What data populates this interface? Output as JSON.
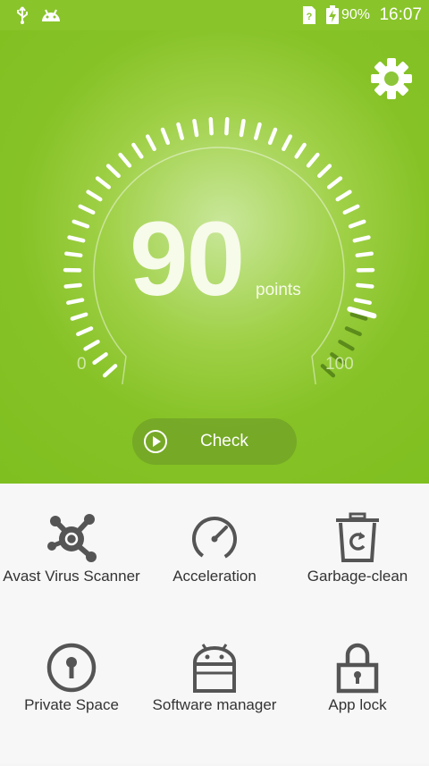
{
  "status_bar": {
    "battery": "90%",
    "time": "16:07"
  },
  "gauge": {
    "score": "90",
    "unit": "points",
    "min_label": "0",
    "max_label": "100",
    "level": 0.9
  },
  "check_button": {
    "label": "Check"
  },
  "tools": [
    {
      "label": "Avast Virus Scanner",
      "icon": "avast-icon"
    },
    {
      "label": "Acceleration",
      "icon": "speedometer-icon"
    },
    {
      "label": "Garbage-clean",
      "icon": "trash-recycle-icon"
    },
    {
      "label": "Private Space",
      "icon": "keyhole-icon"
    },
    {
      "label": "Software manager",
      "icon": "android-briefcase-icon"
    },
    {
      "label": "App lock",
      "icon": "padlock-icon"
    }
  ],
  "colors": {
    "accent_green": "#86c226",
    "icon_gray": "#555555"
  }
}
